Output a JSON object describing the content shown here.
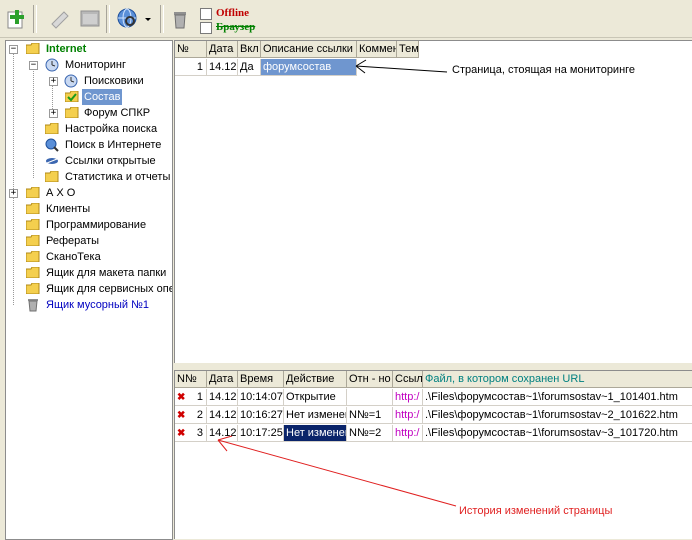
{
  "toolbar": {
    "offline_label": "Offline",
    "browser_label": "Браузер",
    "icons": [
      "add-icon",
      "edit-icon",
      "folder-icon",
      "globe-search-icon",
      "dropdown-icon",
      "trash-icon"
    ]
  },
  "tree": {
    "items": [
      {
        "label": "Internet",
        "icon": "folder-icon"
      },
      {
        "label": "Мониторинг",
        "icon": "clock-icon"
      },
      {
        "label": "Поисковики",
        "icon": "clock-icon"
      },
      {
        "label": "Состав",
        "icon": "folder-check-icon"
      },
      {
        "label": "Форум СПКР",
        "icon": "folder-icon"
      },
      {
        "label": "Настройка поиска",
        "icon": "folder-icon"
      },
      {
        "label": "Поиск в Интернете",
        "icon": "search-globe-icon"
      },
      {
        "label": "Ссылки открытые",
        "icon": "link-icon"
      },
      {
        "label": "Статистика и отчеты",
        "icon": "folder-icon"
      },
      {
        "label": "А Х О",
        "icon": "folder-icon"
      },
      {
        "label": "Клиенты",
        "icon": "folder-icon"
      },
      {
        "label": "Программирование",
        "icon": "folder-icon"
      },
      {
        "label": "Рефераты",
        "icon": "folder-icon"
      },
      {
        "label": "СканоТека",
        "icon": "folder-icon"
      },
      {
        "label": "Ящик для  макета папки",
        "icon": "folder-icon"
      },
      {
        "label": "Ящик для сервисных операций",
        "icon": "folder-icon"
      },
      {
        "label": "Ящик мусорный №1",
        "icon": "trash-icon"
      }
    ]
  },
  "top_grid": {
    "headers": [
      "№",
      "Дата",
      "Вкл",
      "Описание ссылки",
      "Комментарий",
      "Тема"
    ],
    "rows": [
      {
        "n": "1",
        "date": "14.12",
        "on": "Да",
        "desc": "форумсостав"
      }
    ]
  },
  "bottom_grid": {
    "headers": [
      "N№",
      "Дата",
      "Время",
      "Действие",
      "Отн - но",
      "Ссылка",
      "Файл, в котором сохранен URL"
    ],
    "rows": [
      {
        "n": "1",
        "date": "14.12",
        "time": "10:14:07",
        "action": "Открытие",
        "rel": "",
        "link": "http:/",
        "file": ".\\Files\\форумсостав~1\\forumsostav~1_101401.htm"
      },
      {
        "n": "2",
        "date": "14.12",
        "time": "10:16:27",
        "action": "Нет изменения",
        "rel": "N№=1",
        "link": "http:/",
        "file": ".\\Files\\форумсостав~1\\forumsostav~2_101622.htm"
      },
      {
        "n": "3",
        "date": "14.12",
        "time": "10:17:25",
        "action": "Нет изменения",
        "rel": "N№=2",
        "link": "http:/",
        "file": ".\\Files\\форумсостав~1\\forumsostav~3_101720.htm"
      }
    ]
  },
  "annotations": {
    "monitor_page": "Страница, стоящая на мониторинге",
    "history": "История изменений страницы"
  },
  "colors": {
    "annotation_line": "#e02020",
    "selection": "#6f96cf",
    "internet": "#008000"
  }
}
